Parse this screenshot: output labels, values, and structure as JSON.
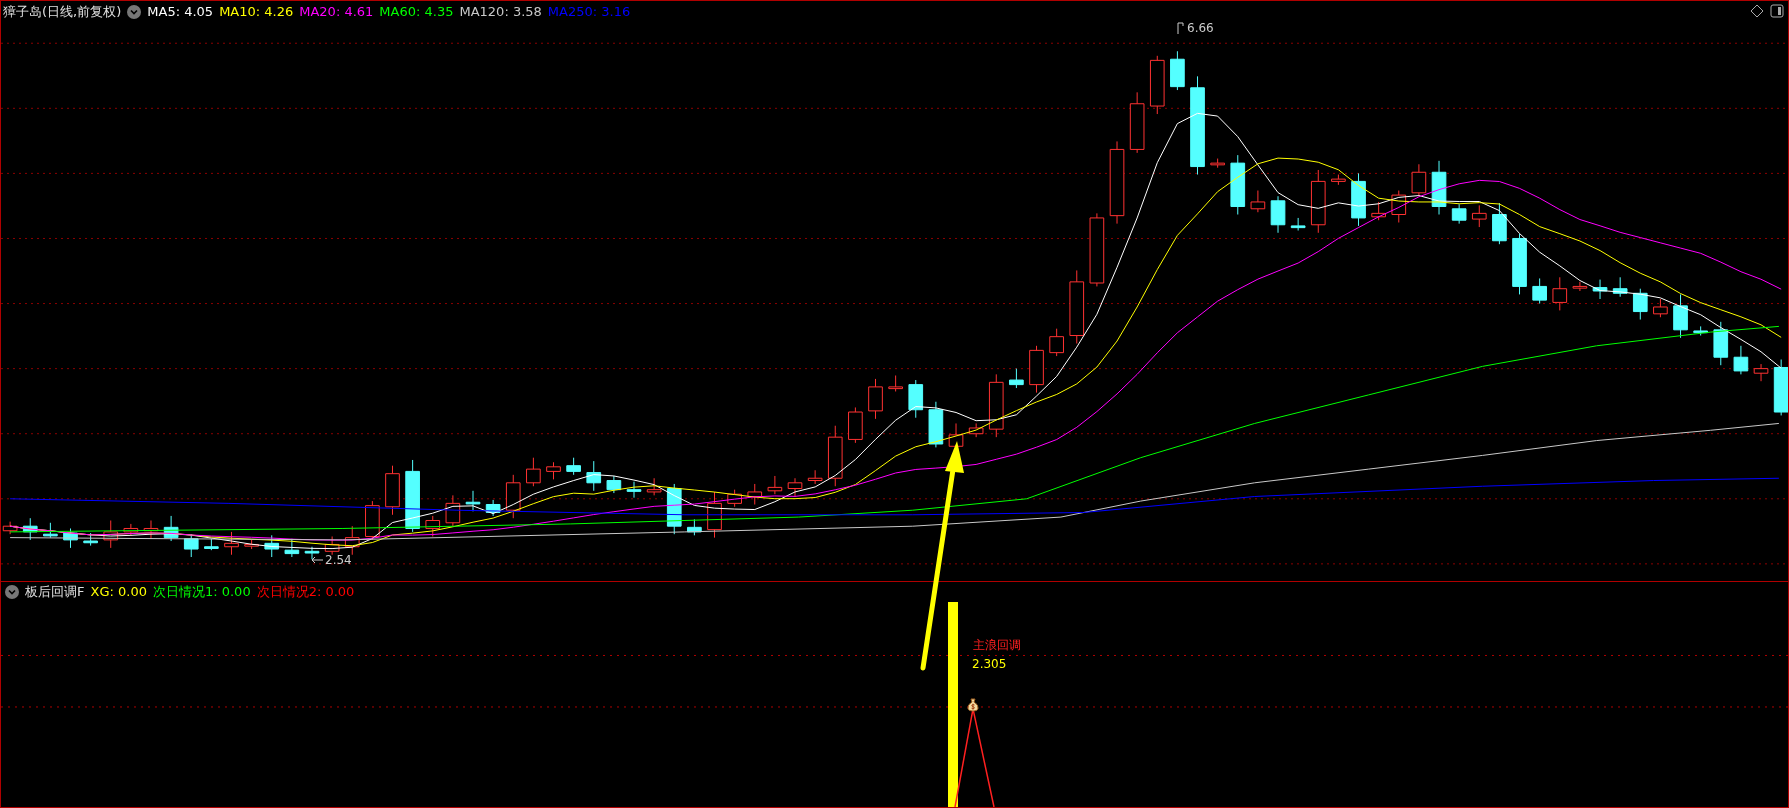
{
  "main_chart": {
    "title": "獐子岛(日线,前复权)",
    "ma": [
      {
        "label": "MA5: 4.05",
        "color": "#ffffff"
      },
      {
        "label": "MA10: 4.26",
        "color": "#ffff00"
      },
      {
        "label": "MA20: 4.61",
        "color": "#ff00ff"
      },
      {
        "label": "MA60: 4.35",
        "color": "#00ff00"
      },
      {
        "label": "MA120: 3.58",
        "color": "#c8c8c8"
      },
      {
        "label": "MA250: 3.16",
        "color": "#0000ff"
      }
    ],
    "high_label": "6.66",
    "low_label": "2.54"
  },
  "indicator": {
    "title": "板后回调F",
    "values": [
      {
        "label": "XG: 0.00",
        "color": "#ffff00"
      },
      {
        "label": "次日情况1: 0.00",
        "color": "#00ff00"
      },
      {
        "label": "次日情况2: 0.00",
        "color": "#ff0000"
      }
    ],
    "signal_label": "主浪回调",
    "signal_value": "2.305"
  }
}
